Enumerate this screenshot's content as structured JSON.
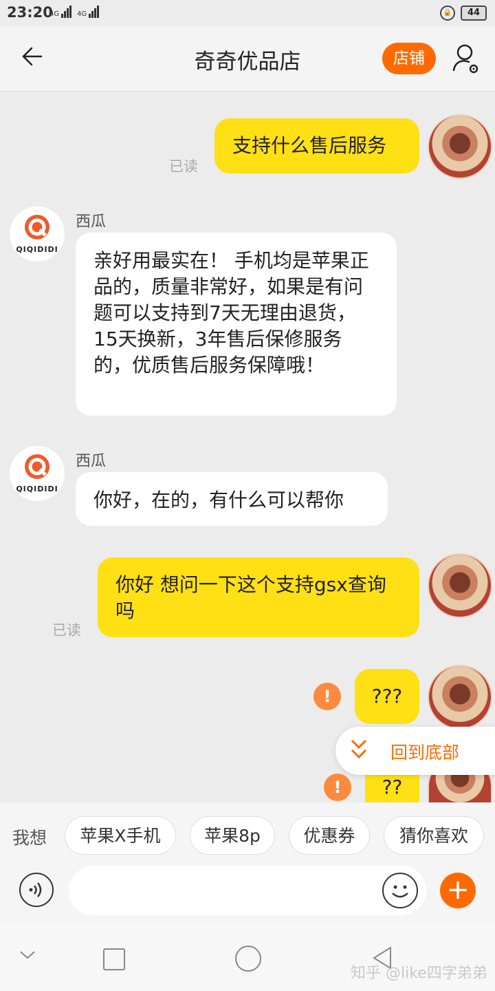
{
  "status_bar": {
    "time": "23:20",
    "net1": "4G",
    "net2": "4G",
    "battery": "44"
  },
  "header": {
    "back_icon": "arrow-left-icon",
    "title": "奇奇优品店",
    "shop_button": "店铺",
    "user_icon": "user-settings-icon"
  },
  "messages": [
    {
      "side": "me",
      "text": "支持什么售后服务",
      "read": "已读"
    },
    {
      "side": "other",
      "sender": "西瓜",
      "avatar_text": "QIQIDIDI",
      "text": "亲好用最实在！ 手机均是苹果正品的，质量非常好，如果是有问题可以支持到7天无理由退货，15天换新，3年售后保修服务的，优质售后服务保障哦！"
    },
    {
      "side": "other",
      "sender": "西瓜",
      "avatar_text": "QIQIDIDI",
      "text": "你好，在的，有什么可以帮你"
    },
    {
      "side": "me",
      "text": "你好 想问一下这个支持gsx查询吗",
      "read": "已读"
    },
    {
      "side": "me",
      "text": "???",
      "failed_icon": "!"
    },
    {
      "side": "me",
      "text": "??",
      "failed_icon": "!"
    }
  ],
  "back_to_bottom": {
    "label": "回到底部",
    "icon": "double-chevron-down-icon"
  },
  "quick_bar": {
    "label": "我想",
    "chips": [
      "苹果X手机",
      "苹果8p",
      "优惠券",
      "猜你喜欢"
    ]
  },
  "input": {
    "placeholder": "",
    "voice_icon": "voice-icon",
    "emoji_icon": "emoji-icon",
    "plus_icon": "plus-icon"
  },
  "nav": {
    "watermark": "知乎 @like四字弟弟"
  },
  "colors": {
    "accent": "#ff6a00",
    "my_bubble": "#ffe014",
    "warn": "#ff8a3d"
  }
}
